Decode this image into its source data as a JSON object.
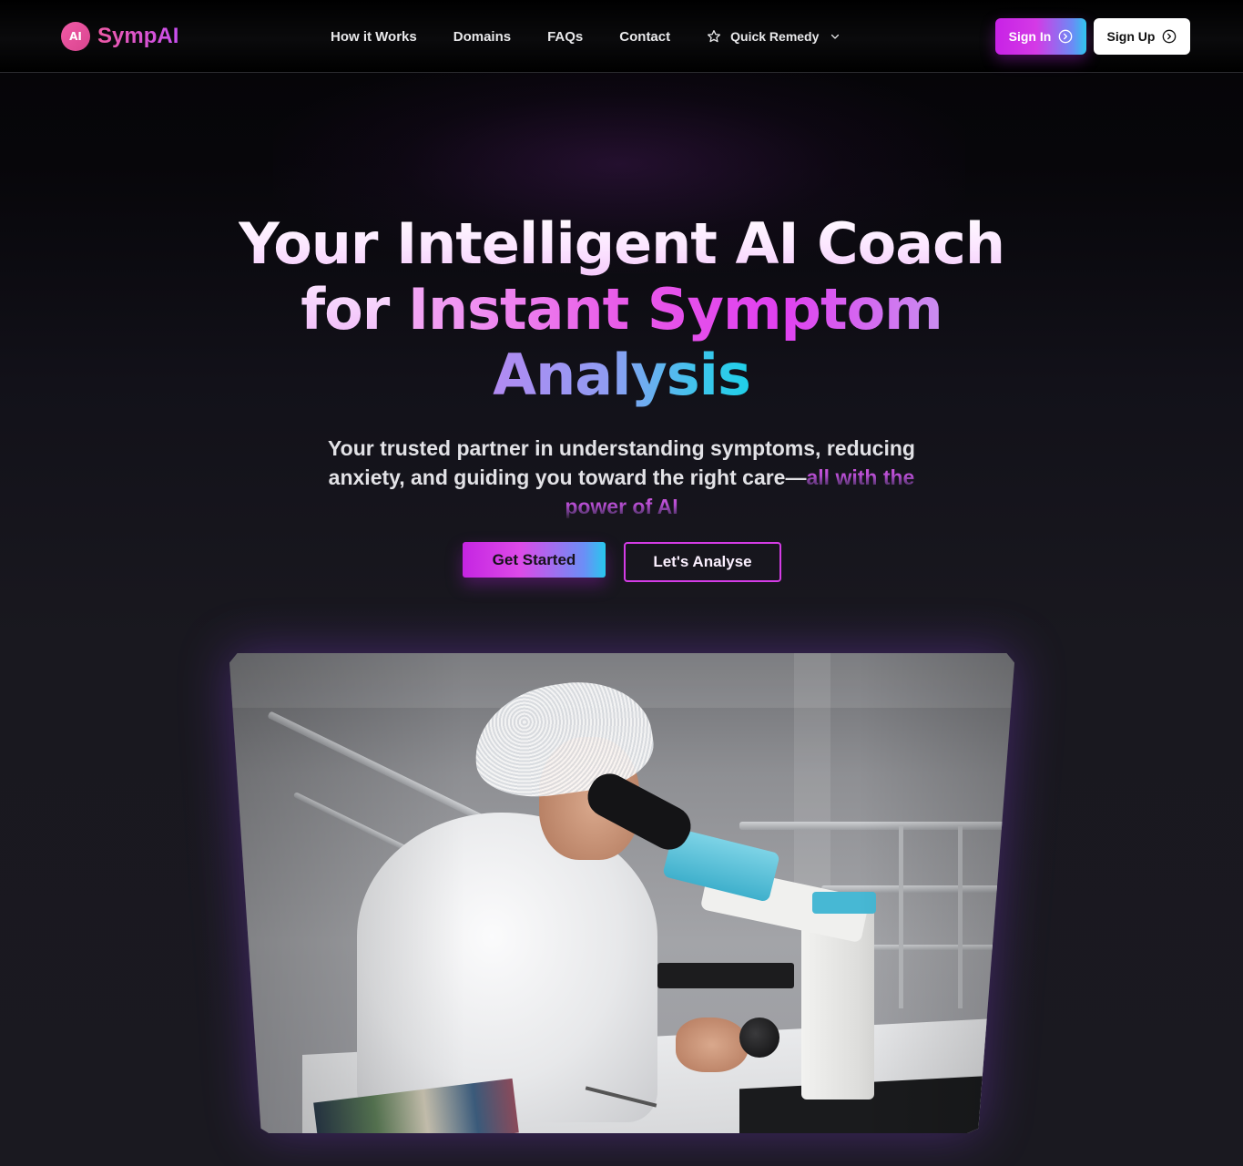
{
  "navbar": {
    "logo": {
      "badge": "AI",
      "name": "SympAI"
    },
    "links": [
      {
        "label": "How it Works"
      },
      {
        "label": "Domains"
      },
      {
        "label": "FAQs"
      },
      {
        "label": "Contact"
      }
    ],
    "quick_remedy": {
      "label": "Quick Remedy",
      "icon": "star-icon",
      "dropdown_icon": "chevron-down-icon"
    },
    "sign_in": {
      "label": "Sign In",
      "icon": "arrow-right-circle-icon"
    },
    "sign_up": {
      "label": "Sign Up",
      "icon": "arrow-right-circle-icon"
    }
  },
  "hero": {
    "title": {
      "line1": "Your Intelligent AI Coach",
      "line2_a": "for ",
      "line2_b": "Instant Symptom",
      "line3": "Analysis"
    },
    "subtitle": {
      "text": "Your trusted partner in understanding symptoms, reducing anxiety, and guiding you toward the right care—",
      "highlight": "all with the power of AI"
    },
    "buttons": {
      "get_started": "Get Started",
      "lets_analyse": "Let's Analyse"
    },
    "image": {
      "subject": "scientist-with-microscope"
    }
  },
  "colors": {
    "accent_magenta": "#d43ae6",
    "accent_cyan": "#2fc6ee",
    "logo_pink": "#f05aa6",
    "background": "#1a1920"
  }
}
